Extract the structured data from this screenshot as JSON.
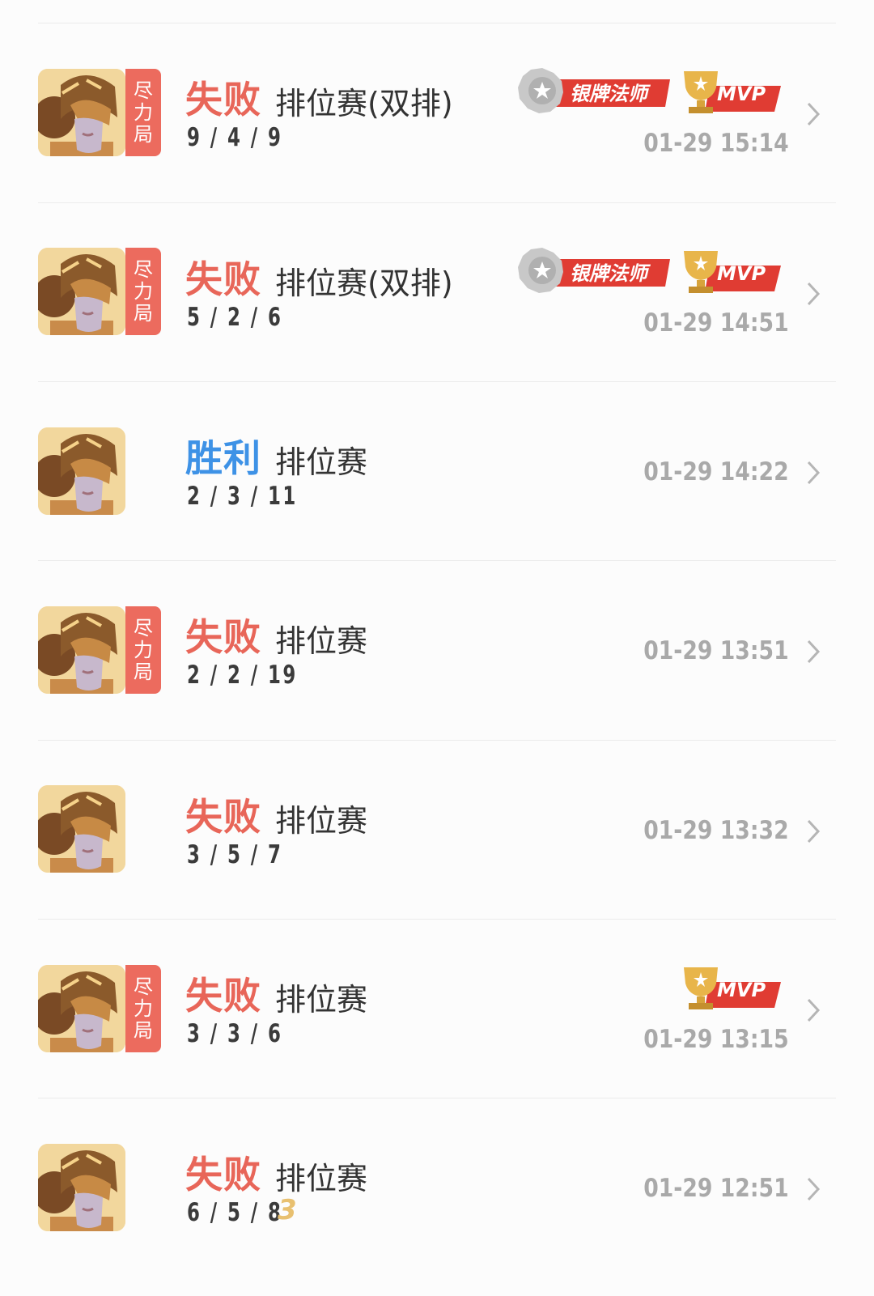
{
  "matches": [
    {
      "result": "失败",
      "result_type": "lose",
      "mode": "排位赛(双排)",
      "kda": "9 / 4 / 9",
      "time": "01-29 15:14",
      "tag": [
        "尽",
        "力",
        "局"
      ],
      "silver_badge": "银牌法师",
      "mvp": "MVP"
    },
    {
      "result": "失败",
      "result_type": "lose",
      "mode": "排位赛(双排)",
      "kda": "5 / 2 / 6",
      "time": "01-29 14:51",
      "tag": [
        "尽",
        "力",
        "局"
      ],
      "silver_badge": "银牌法师",
      "mvp": "MVP"
    },
    {
      "result": "胜利",
      "result_type": "win",
      "mode": "排位赛",
      "kda": "2 / 3 / 11",
      "time": "01-29 14:22"
    },
    {
      "result": "失败",
      "result_type": "lose",
      "mode": "排位赛",
      "kda": "2 / 2 / 19",
      "time": "01-29 13:51",
      "tag": [
        "尽",
        "力",
        "局"
      ]
    },
    {
      "result": "失败",
      "result_type": "lose",
      "mode": "排位赛",
      "kda": "3 / 5 / 7",
      "time": "01-29 13:32"
    },
    {
      "result": "失败",
      "result_type": "lose",
      "mode": "排位赛",
      "kda": "3 / 3 / 6",
      "time": "01-29 13:15",
      "tag": [
        "尽",
        "力",
        "局"
      ],
      "mvp": "MVP"
    },
    {
      "result": "失败",
      "result_type": "lose",
      "mode": "排位赛",
      "kda": "6 / 5 / 8",
      "time": "01-29 12:51",
      "rank_badge": "3"
    }
  ],
  "colors": {
    "lose": "#e86659",
    "win": "#3e92e6",
    "tag_bg": "#ec6b5e",
    "time": "#a9a9a9",
    "mvp_red": "#e03c33",
    "silver": "#c8c8c8"
  },
  "icons": {
    "chevron": "chevron-right-icon",
    "avatar": "hero-avatar",
    "mvp": "trophy-icon",
    "silver": "silver-medal-icon"
  }
}
